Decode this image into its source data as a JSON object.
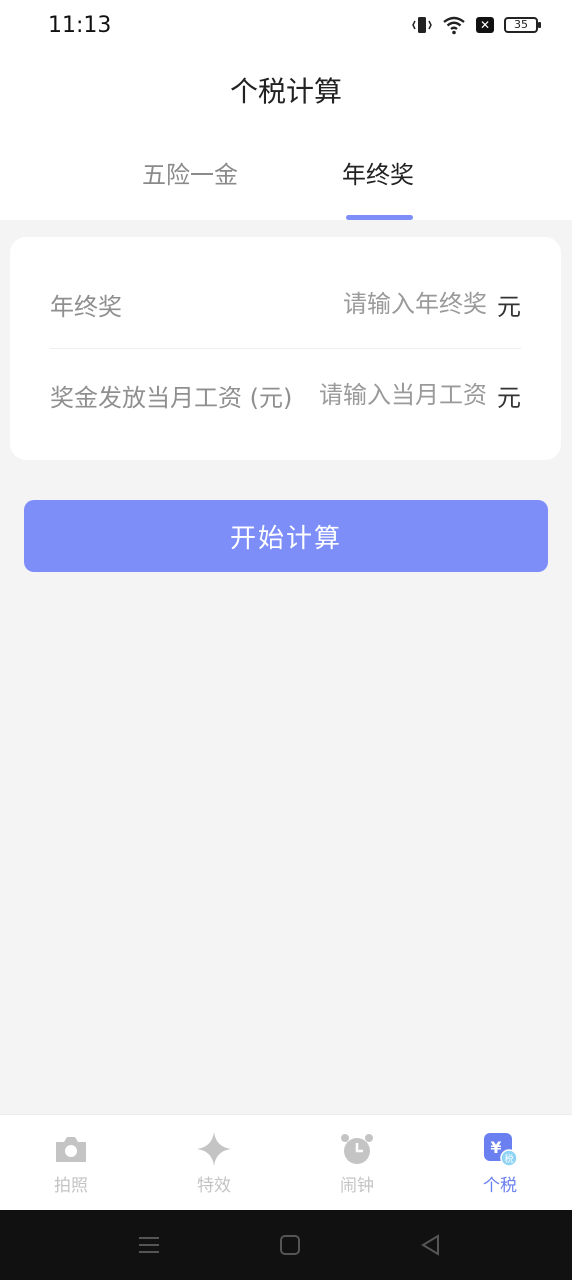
{
  "status_bar": {
    "time": "11:13",
    "battery": "35"
  },
  "header": {
    "title": "个税计算"
  },
  "tabs": [
    {
      "label": "五险一金",
      "active": false
    },
    {
      "label": "年终奖",
      "active": true
    }
  ],
  "form": {
    "bonus": {
      "label": "年终奖",
      "placeholder": "请输入年终奖",
      "unit": "元"
    },
    "salary": {
      "label": "奖金发放当月工资 (元)",
      "placeholder": "请输入当月工资",
      "unit": "元"
    }
  },
  "actions": {
    "calculate_label": "开始计算"
  },
  "bottom_nav": [
    {
      "label": "拍照",
      "icon": "camera-icon"
    },
    {
      "label": "特效",
      "icon": "sparkle-icon"
    },
    {
      "label": "闹钟",
      "icon": "alarm-clock-icon"
    },
    {
      "label": "个税",
      "icon": "tax-yuan-icon",
      "active": true
    }
  ],
  "colors": {
    "accent": "#7d8ef8",
    "background": "#f4f4f5",
    "inactive_nav": "#c4c4c4"
  }
}
